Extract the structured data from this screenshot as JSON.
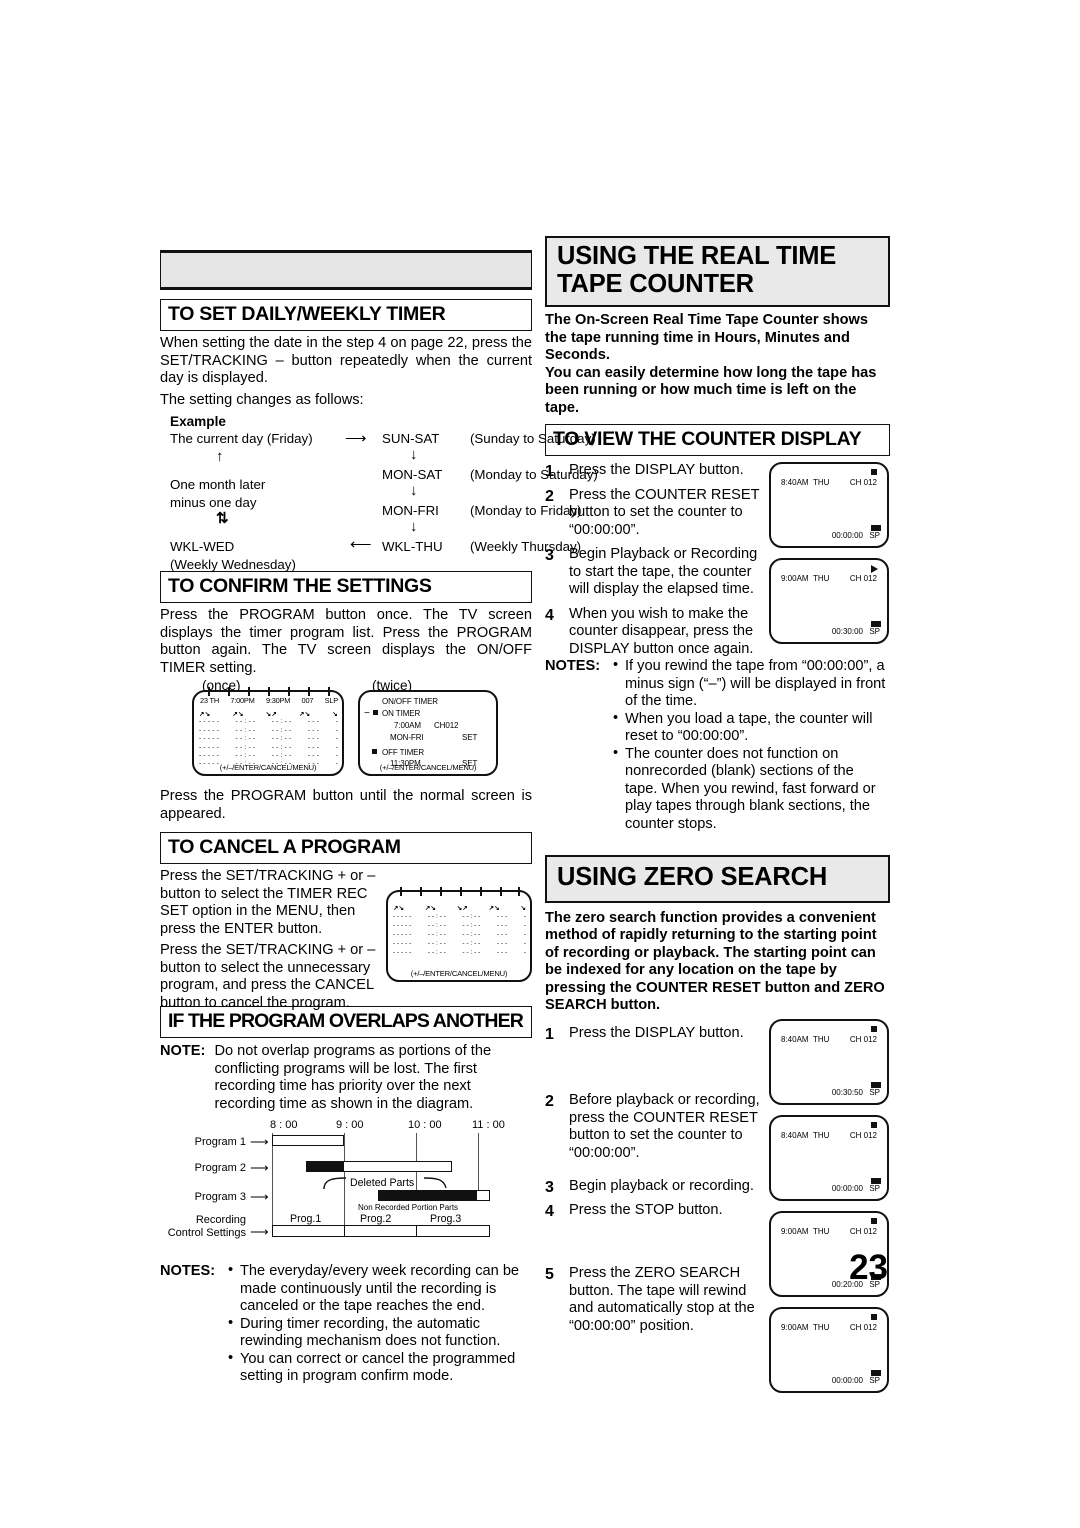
{
  "page": {
    "number": "23"
  },
  "left_column": {
    "empty_banner": "",
    "daily_weekly": {
      "heading": "TO SET DAILY/WEEKLY TIMER",
      "body": "When setting the date in the step 4 on page 22, press the SET/TRACKING – button repeatedly when the current day is displayed.",
      "body2": "The setting changes as follows:",
      "example_label": "Example",
      "flow": {
        "current_day": "The current day (Friday)",
        "one_month_later": "One month later",
        "minus_one_day": "minus one day",
        "wkl_wed": "WKL-WED",
        "wkl_wed_note": "(Weekly Wednesday)",
        "items": [
          {
            "code": "SUN-SAT",
            "desc": "(Sunday to Saturday)"
          },
          {
            "code": "MON-SAT",
            "desc": "(Monday to Saturday)"
          },
          {
            "code": "MON-FRI",
            "desc": "(Monday to Friday)"
          },
          {
            "code": "WKL-THU",
            "desc": "(Weekly Thursday)"
          }
        ]
      }
    },
    "confirm": {
      "heading": "TO CONFIRM THE SETTINGS",
      "body": "Press the PROGRAM button once. The TV screen displays the timer program list. Press the PROGRAM button again. The TV screen displays the ON/OFF TIMER setting.",
      "once_label": "(once)",
      "twice_label": "(twice)",
      "program_list": {
        "header": [
          "23 TH",
          "7:00PM",
          "9:30PM",
          "007",
          "SLP"
        ],
        "empty_row": [
          "- - - - -",
          "- - : - -",
          "- - : - -",
          "- - -",
          "-"
        ],
        "footer": "(+/–/ENTER/CANCEL/MENU)"
      },
      "onoff_timer": {
        "title": "ON/OFF TIMER",
        "on_label": "ON TIMER",
        "on_time": "7:00AM",
        "on_channel": "CH012",
        "on_days": "MON-FRI",
        "on_set": "SET",
        "off_label": "OFF TIMER",
        "off_time": "11:30PM",
        "off_set": "SET",
        "footer": "(+/–/ENTER/CANCEL/MENU)"
      },
      "after_body": "Press the PROGRAM button until the normal screen is appeared."
    },
    "cancel": {
      "heading": "TO CANCEL A PROGRAM",
      "body": "Press the SET/TRACKING + or – button to select the TIMER REC SET option in the MENU, then press the ENTER button.",
      "body2": "Press the SET/TRACKING + or – button to select the unnecessary program, and press the CANCEL button to cancel the program.",
      "screen_footer": "(+/–/ENTER/CANCEL/MENU)",
      "screen_empty_row": [
        "- - - - -",
        "- - : - -",
        "- - : - -",
        "- - -",
        "-"
      ]
    },
    "overlaps": {
      "heading": "IF THE PROGRAM OVERLAPS ANOTHER",
      "note_label": "NOTE:",
      "note_text": "Do not overlap programs as portions of the conflicting programs will be lost. The first recording time has priority over the next recording time as shown in the diagram.",
      "diagram": {
        "times": [
          "8 : 00",
          "9 : 00",
          "10 : 00",
          "11 : 00"
        ],
        "rows": [
          "Program 1",
          "Program 2",
          "Program 3"
        ],
        "recording_label_1": "Recording",
        "recording_label_2": "Control Settings",
        "deleted_parts": "Deleted Parts",
        "non_recorded": "Non Recorded Portion Parts",
        "result_blocks": [
          "Prog.1",
          "Prog.2",
          "Prog.3"
        ]
      }
    },
    "notes": {
      "label": "NOTES:",
      "items": [
        "The everyday/every week recording can be made continuously until the recording is canceled or the tape reaches the end.",
        "During timer recording, the automatic rewinding mechanism does not function.",
        "You can correct or cancel the programmed setting in program confirm mode."
      ]
    }
  },
  "right_column": {
    "title": "USING THE REAL TIME TAPE COUNTER",
    "intro": "The On-Screen Real Time Tape Counter shows the tape running time in Hours, Minutes and Seconds.\nYou can easily determine how long the tape has been running or how much time is left on the tape.",
    "view_counter": {
      "heading": "TO VIEW THE COUNTER DISPLAY",
      "steps": [
        {
          "num": "1",
          "text": "Press the DISPLAY button."
        },
        {
          "num": "2",
          "text": "Press the COUNTER RESET button to set the counter to “00:00:00”."
        },
        {
          "num": "3",
          "text": "Begin Playback or Recording to start the tape, the counter will display the elapsed time."
        },
        {
          "num": "4",
          "text": "When you wish to make the counter disappear, press the DISPLAY button once again."
        }
      ],
      "screens": [
        {
          "time": "8:40AM",
          "day": "THU",
          "channel": "CH 012",
          "mode_icon": "stop-icon",
          "counter": "00:00:00",
          "speed": "SP"
        },
        {
          "time": "9:00AM",
          "day": "THU",
          "channel": "CH 012",
          "mode_icon": "play-icon",
          "counter": "00:30:00",
          "speed": "SP"
        }
      ]
    },
    "counter_notes": {
      "label": "NOTES:",
      "items": [
        "If you rewind the tape from “00:00:00”, a minus sign (“–”) will be displayed in front of the time.",
        "When you load a tape, the counter will reset to “00:00:00”.",
        "The counter does not function on nonrecorded (blank) sections of the tape. When you rewind, fast forward or play tapes through blank sections, the counter stops."
      ]
    },
    "zero_search": {
      "title": "USING ZERO SEARCH",
      "intro": "The zero search function provides a convenient method of rapidly returning to the starting point of recording or playback. The starting point can be indexed for any location on the tape by pressing the COUNTER RESET button and ZERO SEARCH button.",
      "steps": [
        {
          "num": "1",
          "text": "Press the DISPLAY button."
        },
        {
          "num": "2",
          "text": "Before playback or recording, press the COUNTER RESET button to set the counter to “00:00:00”."
        },
        {
          "num": "3",
          "text": "Begin playback or recording."
        },
        {
          "num": "4",
          "text": "Press the STOP button."
        },
        {
          "num": "5",
          "text": "Press the ZERO SEARCH button. The tape will rewind and automatically stop at the “00:00:00” position."
        }
      ],
      "screens": [
        {
          "time": "8:40AM",
          "day": "THU",
          "channel": "CH 012",
          "mode_icon": "stop-icon",
          "counter": "00:30:50",
          "speed": "SP"
        },
        {
          "time": "8:40AM",
          "day": "THU",
          "channel": "CH 012",
          "mode_icon": "stop-icon",
          "counter": "00:00:00",
          "speed": "SP"
        },
        {
          "time": "9:00AM",
          "day": "THU",
          "channel": "CH 012",
          "mode_icon": "stop-icon",
          "counter": "00:20:00",
          "speed": "SP"
        },
        {
          "time": "9:00AM",
          "day": "THU",
          "channel": "CH 012",
          "mode_icon": "stop-icon",
          "counter": "00:00:00",
          "speed": "SP"
        }
      ]
    }
  }
}
